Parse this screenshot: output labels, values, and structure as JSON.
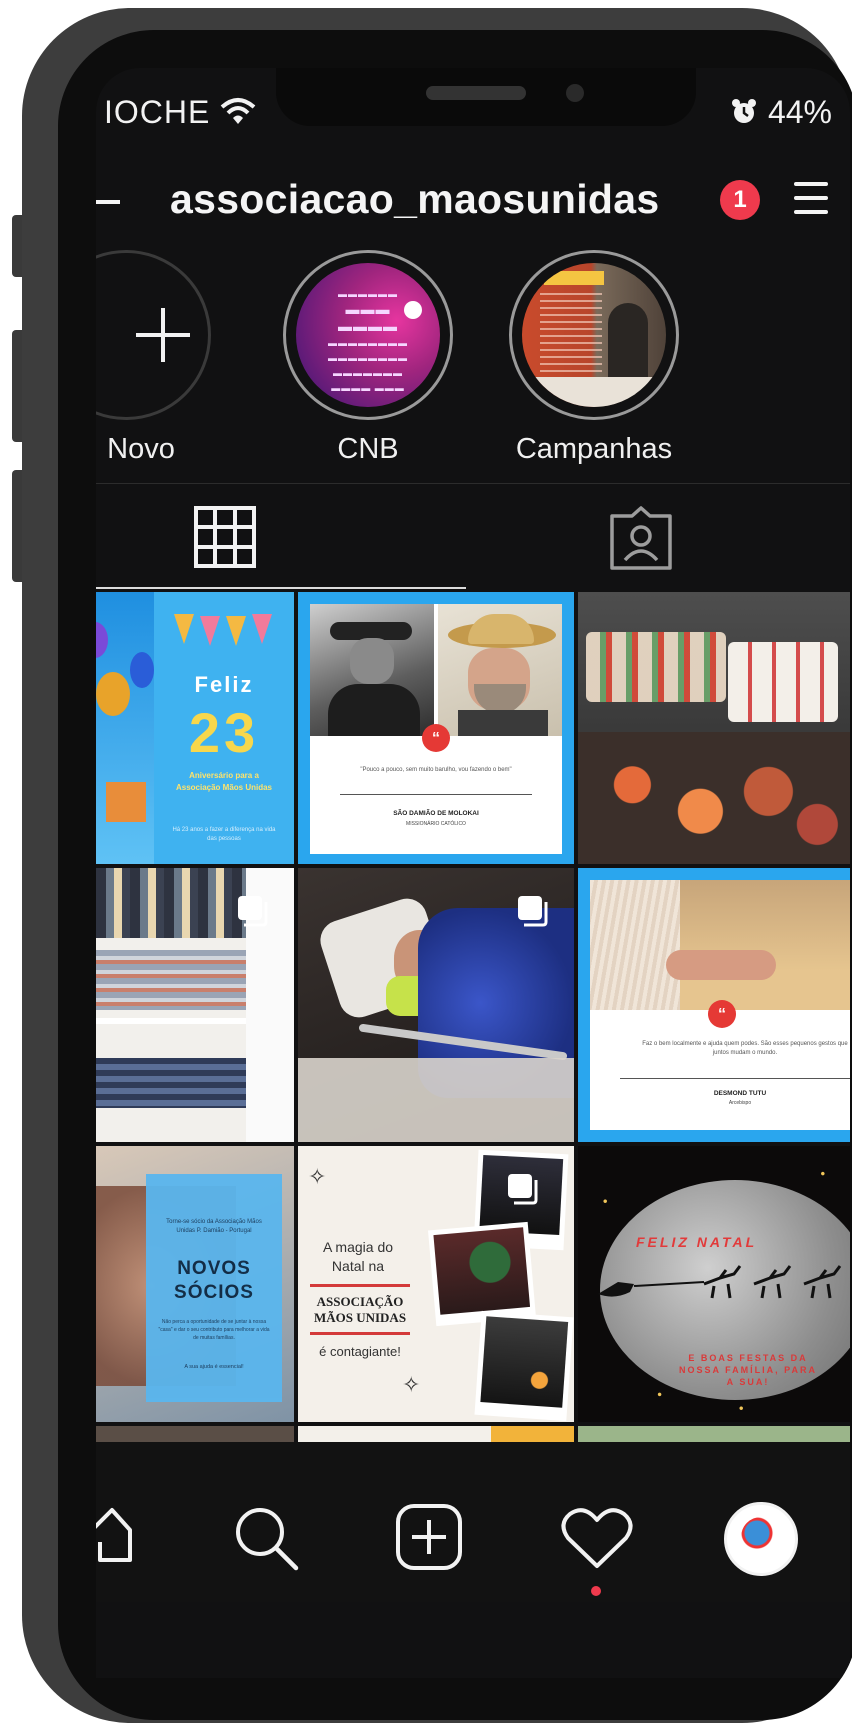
{
  "status_bar": {
    "carrier": "IOCHE",
    "battery": "44%"
  },
  "profile": {
    "username": "associacao_maosunidas",
    "notification_count": "1"
  },
  "highlights": [
    {
      "label": "Novo"
    },
    {
      "label": "CNB"
    },
    {
      "label": "Campanhas"
    }
  ],
  "tabs": {
    "grid": "grid-icon",
    "tagged": "tagged-icon"
  },
  "posts": {
    "p1": {
      "title": "Feliz",
      "number": "23",
      "caption": "Aniversário para a Associação Mãos Unidas",
      "footer": "Há 23 anos a fazer a diferença na vida das pessoas"
    },
    "p2": {
      "quote": "\"Pouco a pouco, sem muito barulho, vou fazendo o bem\"",
      "author": "SÃO DAMIÃO DE MOLOKAI",
      "role": "MISSIONÁRIO CATÓLICO"
    },
    "p6": {
      "quote": "Faz o bem localmente e ajuda quem podes. São esses pequenos gestos que juntos mudam o mundo.",
      "author": "DESMOND TUTU",
      "role": "Arcebispo"
    },
    "p7": {
      "intro": "Torne-se sócio da Associação Mãos Unidas P. Damião - Portugal",
      "headline1": "NOVOS",
      "headline2": "SÓCIOS",
      "body": "Não perca a oportunidade de se juntar à nossa \"casa\" e dar o seu contributo para melhorar a vida de muitas famílias.",
      "footer": "A sua ajuda é essencial!"
    },
    "p8": {
      "line1": "A magia do",
      "line2": "Natal na",
      "org1": "ASSOCIAÇÃO",
      "org2": "MÃOS UNIDAS",
      "line3": "é contagiante!"
    },
    "p9": {
      "title": "FELIZ NATAL",
      "line1": "E BOAS FESTAS DA",
      "line2": "NOSSA FAMÍLIA, PARA",
      "line3": "A SUA!"
    }
  },
  "colors": {
    "badge": "#ef3a4d",
    "accent_blue": "#2aa6ee",
    "background": "#111112",
    "notification_dot": "#ef3a4d"
  }
}
